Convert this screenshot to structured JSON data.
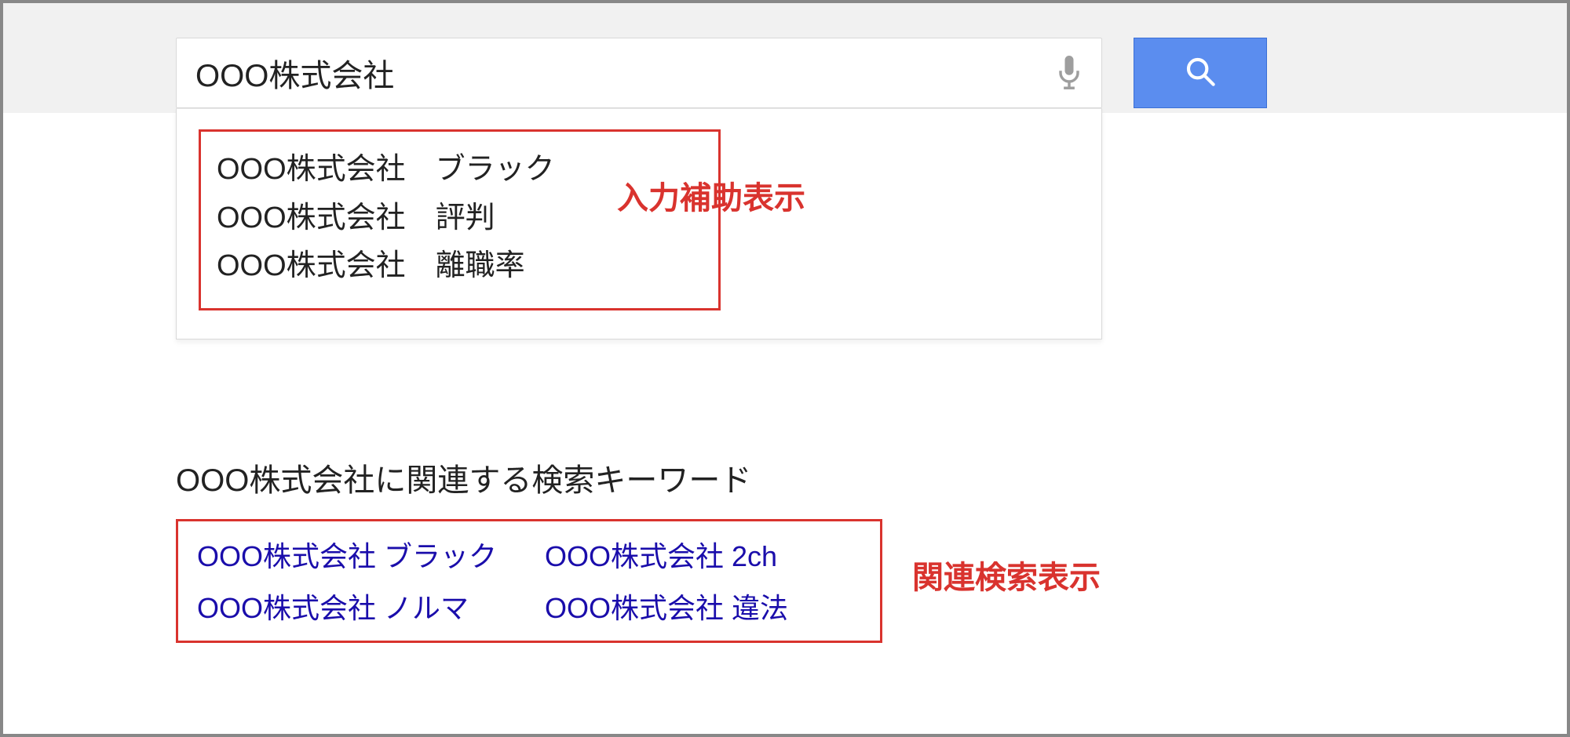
{
  "search": {
    "query": "OOO株式会社",
    "placeholder": ""
  },
  "suggestions": {
    "items": [
      "OOO株式会社　ブラック",
      "OOO株式会社　評判",
      "OOO株式会社　離職率"
    ],
    "annotation": "入力補助表示"
  },
  "related": {
    "heading": "OOO株式会社に関連する検索キーワード",
    "links": [
      "OOO株式会社 ブラック",
      "OOO株式会社 2ch",
      "OOO株式会社 ノルマ",
      "OOO株式会社 違法"
    ],
    "annotation": "関連検索表示"
  }
}
